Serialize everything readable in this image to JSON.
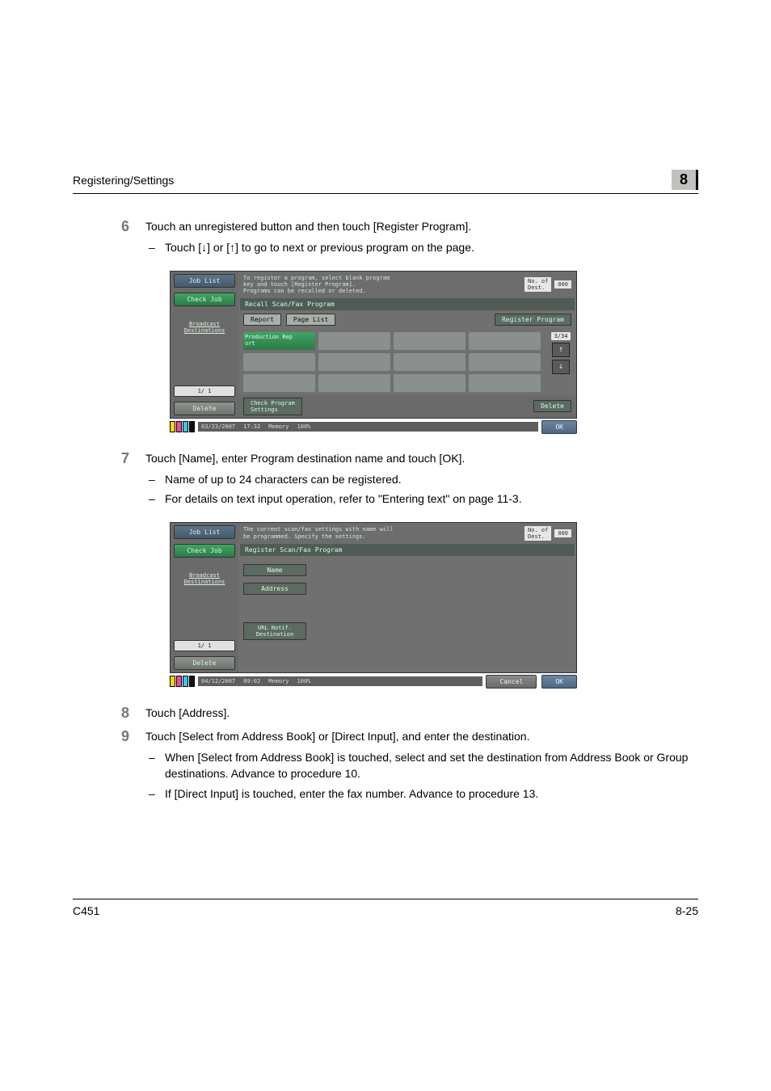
{
  "header": {
    "title": "Registering/Settings",
    "chapter": "8"
  },
  "steps": {
    "s6": {
      "num": "6",
      "text": "Touch an unregistered button and then touch [Register Program].",
      "bullets": [
        "Touch [↓] or [↑] to go to next or previous program on the page."
      ]
    },
    "s7": {
      "num": "7",
      "text": "Touch [Name], enter Program destination name and touch [OK].",
      "bullets": [
        "Name of up to 24 characters can be registered.",
        "For details on text input operation, refer to \"Entering text\" on page 11-3."
      ]
    },
    "s8": {
      "num": "8",
      "text": "Touch [Address]."
    },
    "s9": {
      "num": "9",
      "text": "Touch [Select from Address Book] or [Direct Input], and enter the destination.",
      "bullets": [
        "When [Select from Address Book] is touched, select and set the destination from Address Book or Group destinations. Advance to procedure 10.",
        "If [Direct Input] is touched, enter the fax number. Advance to procedure 13."
      ]
    }
  },
  "screenshot1": {
    "jobList": "Job List",
    "checkJob": "Check Job",
    "broadcast": "Broadcast\nDestinations",
    "pageSide": "1/ 1",
    "delete": "Delete",
    "topMsg": "To register a program, select blank program\nkey and touch [Register Program].\nPrograms can be recalled or deleted.",
    "destLabel": "No. of\nDest.",
    "destCount": "000",
    "title": "Recall Scan/Fax Program",
    "report": "Report",
    "pageList": "Page List",
    "registerProgram": "Register Program",
    "tile": "Production Rep\nort",
    "page": "3/34",
    "checkProgSettings": "Check Program\nSettings",
    "bottomDelete": "Delete",
    "ok": "OK",
    "date": "03/23/2007",
    "time": "17:32",
    "memory": "Memory",
    "memval": "100%"
  },
  "screenshot2": {
    "jobList": "Job List",
    "checkJob": "Check Job",
    "broadcast": "Broadcast\nDestinations",
    "pageSide": "1/ 1",
    "delete": "Delete",
    "topMsg": "The current scan/fax settings with name will\nbe programmed. Specify the settings.",
    "destLabel": "No. of\nDest.",
    "destCount": "000",
    "title": "Register Scan/Fax Program",
    "name": "Name",
    "address": "Address",
    "urlNotif": "URL Notif.\nDestination",
    "cancel": "Cancel",
    "ok": "OK",
    "date": "04/12/2007",
    "time": "09:02",
    "memory": "Memory",
    "memval": "100%"
  },
  "footer": {
    "model": "C451",
    "page": "8-25"
  }
}
